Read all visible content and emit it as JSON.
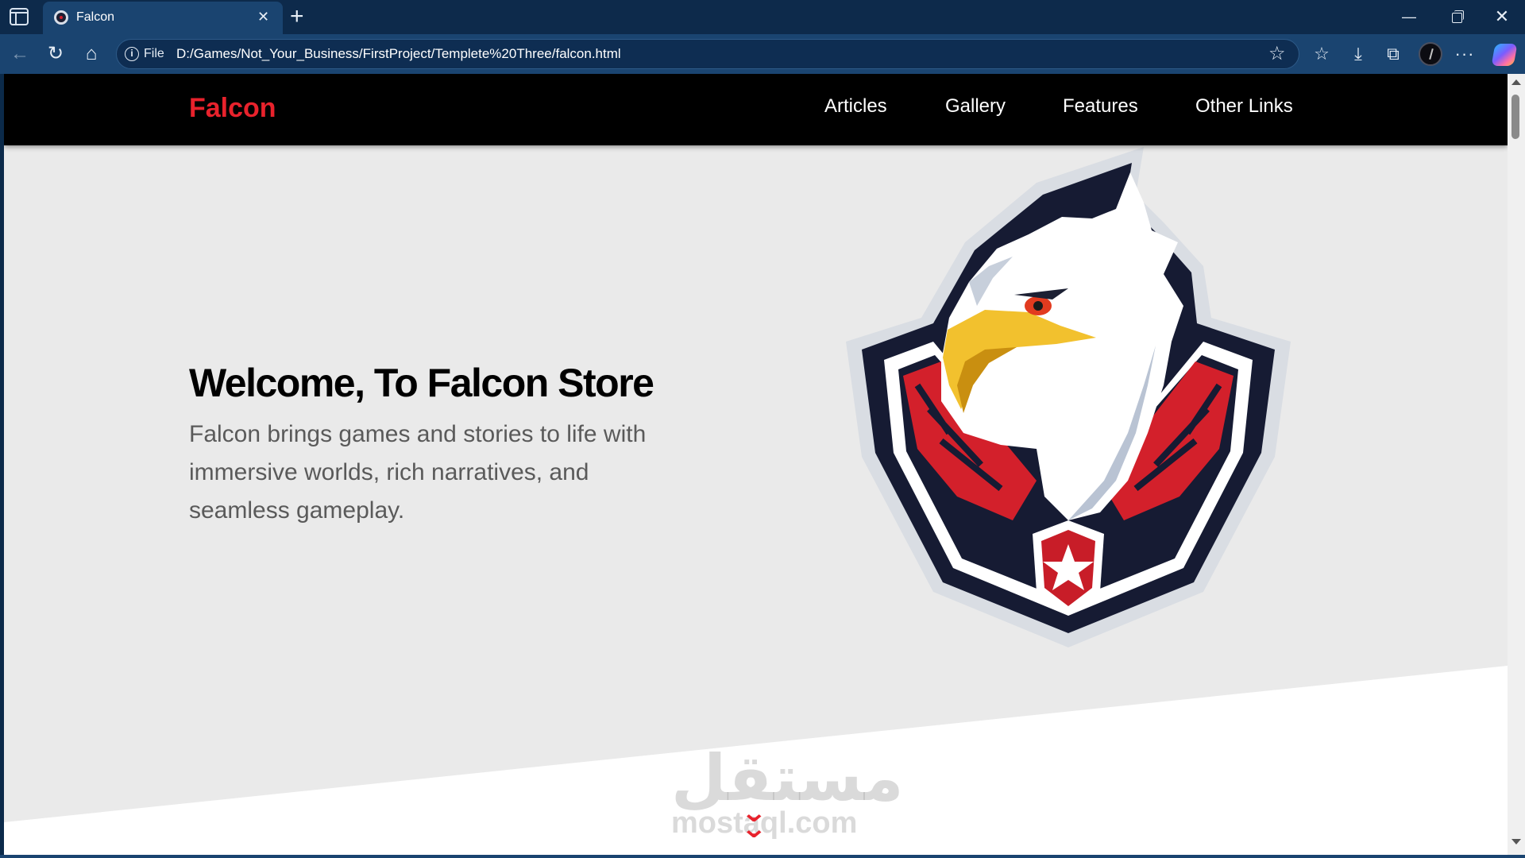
{
  "browser": {
    "tab_title": "Falcon",
    "tab_close": "✕",
    "new_tab": "+",
    "address_label": "File",
    "url": "D:/Games/Not_Your_Business/FirstProject/Templete%20Three/falcon.html",
    "icons": [
      "sidebar-toggle-icon",
      "back-icon",
      "reload-icon",
      "home-icon",
      "info-icon",
      "favorite-star-icon",
      "favorites-icon",
      "download-icon",
      "extensions-icon",
      "profile-avatar",
      "more-icon",
      "copilot-icon"
    ],
    "window_controls": {
      "minimize": "—",
      "close": "✕"
    },
    "more": "···"
  },
  "site": {
    "logo": "Falcon",
    "nav": {
      "articles": "Articles",
      "gallery": "Gallery",
      "features": "Features",
      "other_links": "Other Links"
    },
    "hero": {
      "title": "Welcome, To Falcon Store",
      "description": "Falcon brings games and stories to life with immersive worlds, rich narratives, and seamless gameplay."
    },
    "scroll_down_icon": "double-chevron-down-icon",
    "watermark_ar": "مستقل",
    "watermark_en": "mostaql.com"
  },
  "colors": {
    "brand_red": "#e8222c",
    "header_bg": "#000000",
    "hero_bg": "#eaeaea",
    "browser_frame": "#1a4470"
  }
}
